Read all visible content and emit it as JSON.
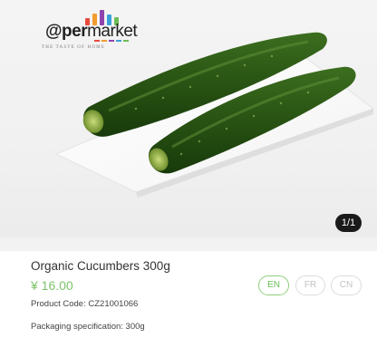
{
  "brand": {
    "name_bold": "@per",
    "name_light": "market",
    "tagline": "THE TASTE OF HOME",
    "bar_colors": [
      "#e9493b",
      "#f39c2f",
      "#8e44ad",
      "#3aa0d8",
      "#6bbd56"
    ]
  },
  "gallery": {
    "image_subject": "cucumber-photo",
    "counter": "1/1"
  },
  "product": {
    "title": "Organic Cucumbers 300g",
    "price": "¥ 16.00",
    "code": "Product Code: CZ21001066",
    "packaging": "Packaging specification: 300g"
  },
  "languages": {
    "en": "EN",
    "fr": "FR",
    "cn": "CN",
    "selected": "EN"
  },
  "colors": {
    "accent_green": "#7dc36b",
    "counter_bg": "#1a1a1a"
  }
}
